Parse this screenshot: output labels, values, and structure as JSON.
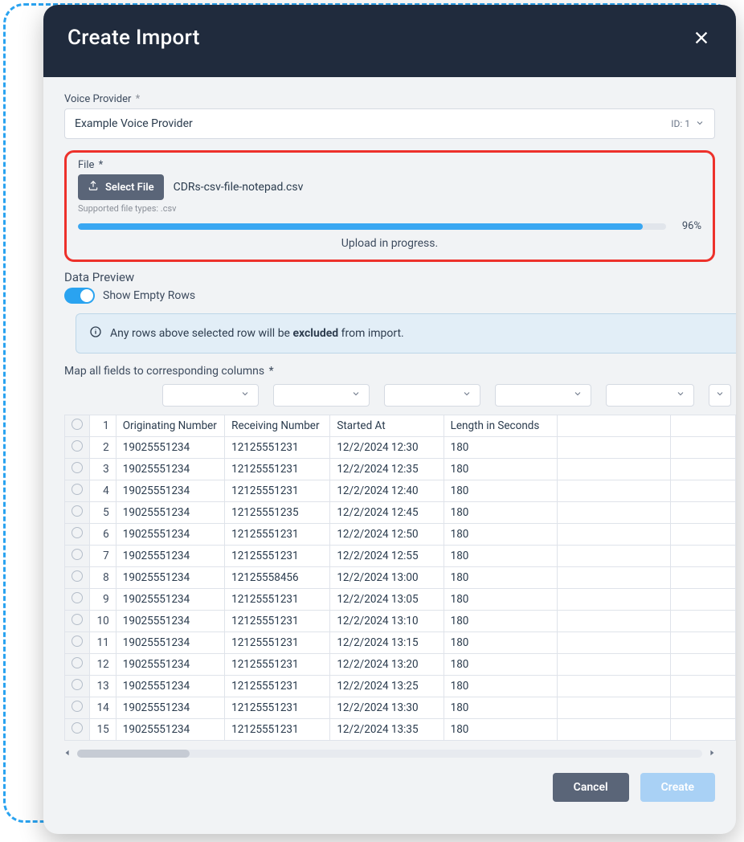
{
  "modal": {
    "title": "Create Import"
  },
  "voice_provider": {
    "label": "Voice Provider",
    "required_mark": "*",
    "value": "Example Voice Provider",
    "id_label": "ID: 1"
  },
  "file": {
    "label": "File",
    "required_mark": "*",
    "button_label": "Select File",
    "filename": "CDRs-csv-file-notepad.csv",
    "supported_text": "Supported file types: .csv",
    "progress_pct": 96,
    "progress_label": "96%",
    "status_text": "Upload in progress."
  },
  "preview": {
    "heading": "Data Preview",
    "toggle_label": "Show Empty Rows",
    "toggle_on": true,
    "info_prefix": "Any rows above selected row will be ",
    "info_bold": "excluded",
    "info_suffix": " from import.",
    "map_label": "Map all fields to corresponding columns",
    "map_required_mark": "*"
  },
  "table": {
    "select_count": 6,
    "headers": [
      "Originating Number",
      "Receiving Number",
      "Started At",
      "Length in Seconds",
      "",
      ""
    ],
    "rows": [
      {
        "idx": 2,
        "cells": [
          "19025551234",
          "12125551231",
          "12/2/2024 12:30",
          "180",
          "",
          ""
        ]
      },
      {
        "idx": 3,
        "cells": [
          "19025551234",
          "12125551231",
          "12/2/2024 12:35",
          "180",
          "",
          ""
        ]
      },
      {
        "idx": 4,
        "cells": [
          "19025551234",
          "12125551231",
          "12/2/2024 12:40",
          "180",
          "",
          ""
        ]
      },
      {
        "idx": 5,
        "cells": [
          "19025551234",
          "12125551235",
          "12/2/2024 12:45",
          "180",
          "",
          ""
        ]
      },
      {
        "idx": 6,
        "cells": [
          "19025551234",
          "12125551231",
          "12/2/2024 12:50",
          "180",
          "",
          ""
        ]
      },
      {
        "idx": 7,
        "cells": [
          "19025551234",
          "12125551231",
          "12/2/2024 12:55",
          "180",
          "",
          ""
        ]
      },
      {
        "idx": 8,
        "cells": [
          "19025551234",
          "12125558456",
          "12/2/2024 13:00",
          "180",
          "",
          ""
        ]
      },
      {
        "idx": 9,
        "cells": [
          "19025551234",
          "12125551231",
          "12/2/2024 13:05",
          "180",
          "",
          ""
        ]
      },
      {
        "idx": 10,
        "cells": [
          "19025551234",
          "12125551231",
          "12/2/2024 13:10",
          "180",
          "",
          ""
        ]
      },
      {
        "idx": 11,
        "cells": [
          "19025551234",
          "12125551231",
          "12/2/2024 13:15",
          "180",
          "",
          ""
        ]
      },
      {
        "idx": 12,
        "cells": [
          "19025551234",
          "12125551231",
          "12/2/2024 13:20",
          "180",
          "",
          ""
        ]
      },
      {
        "idx": 13,
        "cells": [
          "19025551234",
          "12125551231",
          "12/2/2024 13:25",
          "180",
          "",
          ""
        ]
      },
      {
        "idx": 14,
        "cells": [
          "19025551234",
          "12125551231",
          "12/2/2024 13:30",
          "180",
          "",
          ""
        ]
      },
      {
        "idx": 15,
        "cells": [
          "19025551234",
          "12125551231",
          "12/2/2024 13:35",
          "180",
          "",
          ""
        ]
      }
    ]
  },
  "footer": {
    "cancel_label": "Cancel",
    "create_label": "Create"
  }
}
